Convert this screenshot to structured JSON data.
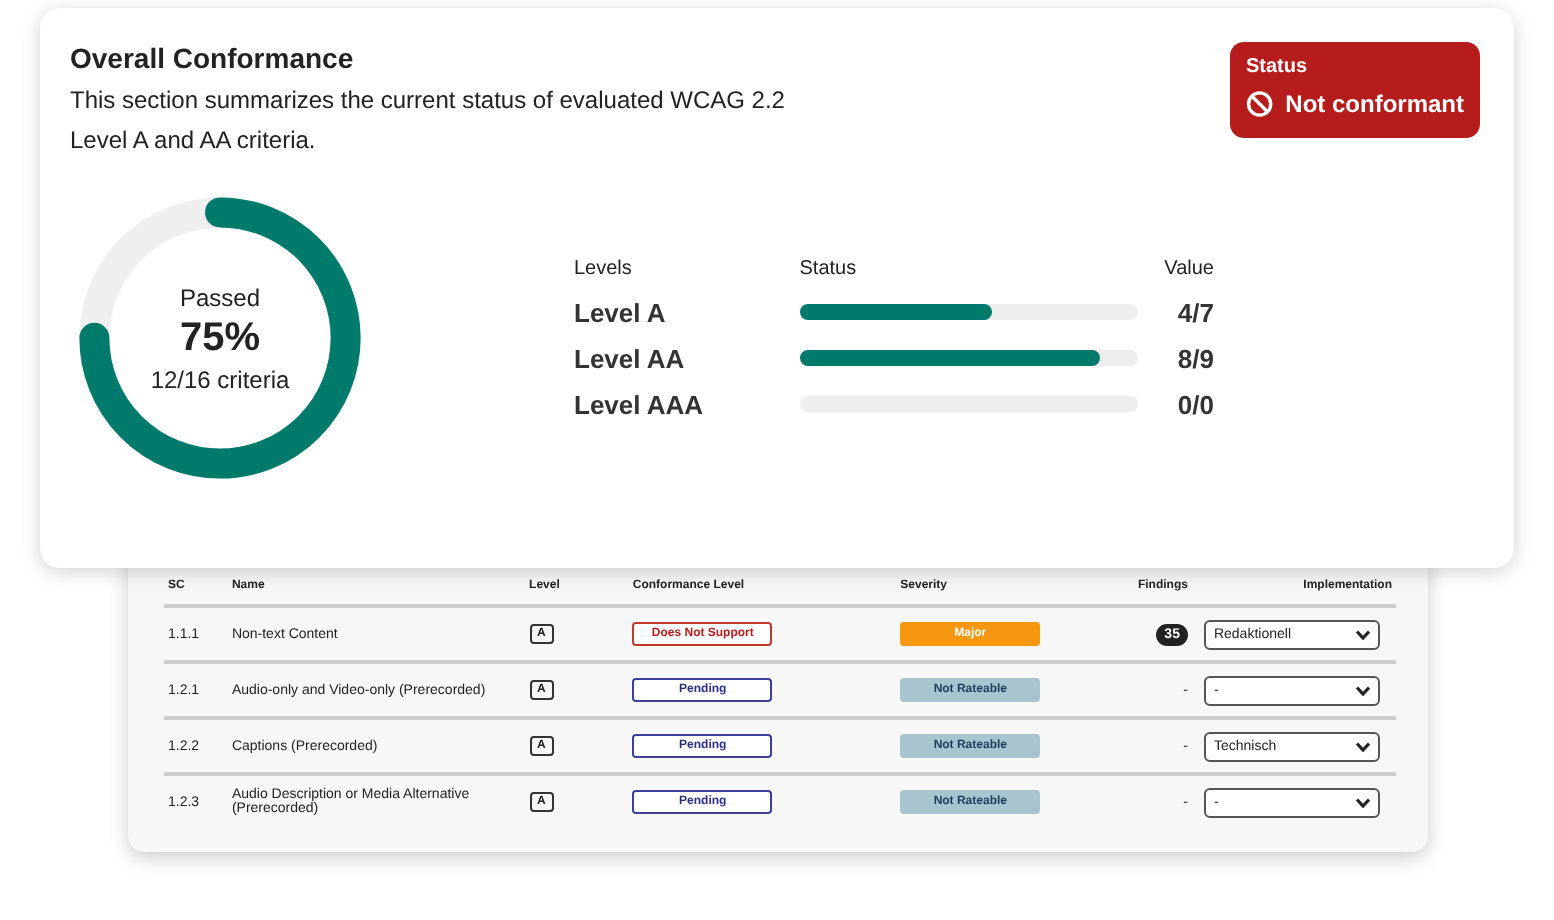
{
  "summary": {
    "title": "Overall Conformance",
    "description": "This section summarizes the current status of evaluated WCAG 2.2 Level A and AA criteria.",
    "status": {
      "label": "Status",
      "value": "Not conformant"
    },
    "donut": {
      "caption": "Passed",
      "percent": "75%",
      "detail": "12/16 criteria",
      "level": 0.75
    },
    "levels_header": {
      "levels": "Levels",
      "status": "Status",
      "value": "Value"
    },
    "levels": [
      {
        "name": "Level A",
        "level": 0.57,
        "value": "4/7"
      },
      {
        "name": "Level AA",
        "level": 0.89,
        "value": "8/9"
      },
      {
        "name": "Level AAA",
        "value": "0/0"
      }
    ]
  },
  "table": {
    "columns": [
      "SC",
      "Name",
      "Level",
      "Conformance Level",
      "Severity",
      "Findings",
      "Implementation"
    ],
    "rows": [
      {
        "sc": "1.1.1",
        "name": "Non-text Content",
        "level": "A",
        "conformance": {
          "kind": "fail",
          "text": "Does Not Support"
        },
        "severity": {
          "kind": "major",
          "text": "Major"
        },
        "findings": {
          "kind": "count",
          "text": "35"
        },
        "implementation": "Redaktionell"
      },
      {
        "sc": "1.2.1",
        "name": "Audio-only and Video-only (Prerecorded)",
        "level": "A",
        "conformance": {
          "kind": "pending",
          "text": "Pending"
        },
        "severity": {
          "kind": "none",
          "text": "Not Rateable"
        },
        "findings": {
          "kind": "dash",
          "text": "-"
        },
        "implementation": "-"
      },
      {
        "sc": "1.2.2",
        "name": "Captions (Prerecorded)",
        "level": "A",
        "conformance": {
          "kind": "pending",
          "text": "Pending"
        },
        "severity": {
          "kind": "none",
          "text": "Not Rateable"
        },
        "findings": {
          "kind": "dash",
          "text": "-"
        },
        "implementation": "Technisch"
      },
      {
        "sc": "1.2.3",
        "name": "Audio Description or Media Alternative (Prerecorded)",
        "level": "A",
        "conformance": {
          "kind": "pending",
          "text": "Pending"
        },
        "severity": {
          "kind": "none",
          "text": "Not Rateable"
        },
        "findings": {
          "kind": "dash",
          "text": "-"
        },
        "implementation": "-"
      }
    ]
  }
}
